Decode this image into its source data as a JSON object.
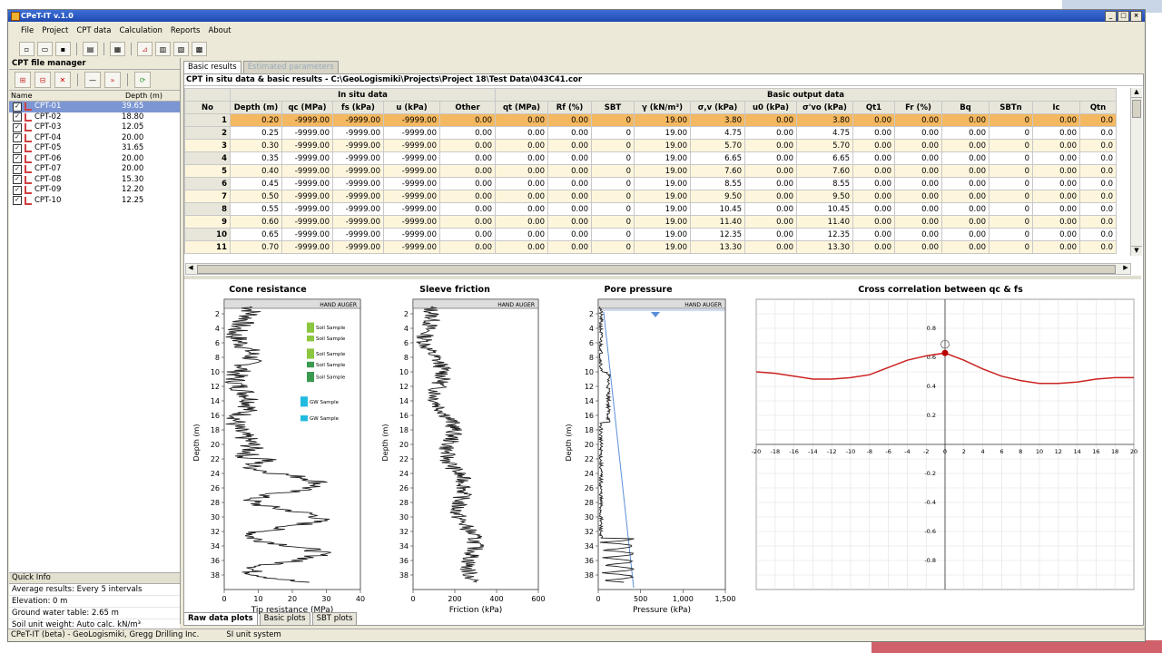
{
  "window": {
    "title": "CPeT-IT v.1.0"
  },
  "menu": [
    "File",
    "Project",
    "CPT data",
    "Calculation",
    "Reports",
    "About"
  ],
  "file_manager": {
    "title": "CPT file manager",
    "col_name": "Name",
    "col_depth": "Depth (m)",
    "files": [
      {
        "name": "CPT-01",
        "depth": "39.65"
      },
      {
        "name": "CPT-02",
        "depth": "18.80"
      },
      {
        "name": "CPT-03",
        "depth": "12.05"
      },
      {
        "name": "CPT-04",
        "depth": "20.00"
      },
      {
        "name": "CPT-05",
        "depth": "31.65"
      },
      {
        "name": "CPT-06",
        "depth": "20.00"
      },
      {
        "name": "CPT-07",
        "depth": "20.00"
      },
      {
        "name": "CPT-08",
        "depth": "15.30"
      },
      {
        "name": "CPT-09",
        "depth": "12.20"
      },
      {
        "name": "CPT-10",
        "depth": "12.25"
      }
    ]
  },
  "quick_info": {
    "title": "Quick Info",
    "lines": [
      "Average results: Every 5 intervals",
      "Elevation: 0 m",
      "Ground water table: 2.65 m",
      "Soil unit weight: Auto calc. kN/m³"
    ]
  },
  "tabs": {
    "basic": "Basic results",
    "estimated": "Estimated parameters"
  },
  "path": "CPT in situ data & basic results - C:\\GeoLogismiki\\Projects\\Project 18\\Test Data\\043C41.cor",
  "table": {
    "group_insitu": "In situ data",
    "group_output": "Basic output data",
    "columns": [
      "No",
      "Depth (m)",
      "qc (MPa)",
      "fs (kPa)",
      "u (kPa)",
      "Other",
      "qt (MPa)",
      "Rf (%)",
      "SBT",
      "γ (kN/m³)",
      "σ,v (kPa)",
      "u0 (kPa)",
      "σ'vo (kPa)",
      "Qt1",
      "Fr (%)",
      "Bq",
      "SBTn",
      "Ic",
      "Qtn"
    ],
    "rows": [
      [
        "1",
        "0.20",
        "-9999.00",
        "-9999.00",
        "-9999.00",
        "0.00",
        "0.00",
        "0.00",
        "0",
        "19.00",
        "3.80",
        "0.00",
        "3.80",
        "0.00",
        "0.00",
        "0.00",
        "0",
        "0.00",
        "0.0"
      ],
      [
        "2",
        "0.25",
        "-9999.00",
        "-9999.00",
        "-9999.00",
        "0.00",
        "0.00",
        "0.00",
        "0",
        "19.00",
        "4.75",
        "0.00",
        "4.75",
        "0.00",
        "0.00",
        "0.00",
        "0",
        "0.00",
        "0.0"
      ],
      [
        "3",
        "0.30",
        "-9999.00",
        "-9999.00",
        "-9999.00",
        "0.00",
        "0.00",
        "0.00",
        "0",
        "19.00",
        "5.70",
        "0.00",
        "5.70",
        "0.00",
        "0.00",
        "0.00",
        "0",
        "0.00",
        "0.0"
      ],
      [
        "4",
        "0.35",
        "-9999.00",
        "-9999.00",
        "-9999.00",
        "0.00",
        "0.00",
        "0.00",
        "0",
        "19.00",
        "6.65",
        "0.00",
        "6.65",
        "0.00",
        "0.00",
        "0.00",
        "0",
        "0.00",
        "0.0"
      ],
      [
        "5",
        "0.40",
        "-9999.00",
        "-9999.00",
        "-9999.00",
        "0.00",
        "0.00",
        "0.00",
        "0",
        "19.00",
        "7.60",
        "0.00",
        "7.60",
        "0.00",
        "0.00",
        "0.00",
        "0",
        "0.00",
        "0.0"
      ],
      [
        "6",
        "0.45",
        "-9999.00",
        "-9999.00",
        "-9999.00",
        "0.00",
        "0.00",
        "0.00",
        "0",
        "19.00",
        "8.55",
        "0.00",
        "8.55",
        "0.00",
        "0.00",
        "0.00",
        "0",
        "0.00",
        "0.0"
      ],
      [
        "7",
        "0.50",
        "-9999.00",
        "-9999.00",
        "-9999.00",
        "0.00",
        "0.00",
        "0.00",
        "0",
        "19.00",
        "9.50",
        "0.00",
        "9.50",
        "0.00",
        "0.00",
        "0.00",
        "0",
        "0.00",
        "0.0"
      ],
      [
        "8",
        "0.55",
        "-9999.00",
        "-9999.00",
        "-9999.00",
        "0.00",
        "0.00",
        "0.00",
        "0",
        "19.00",
        "10.45",
        "0.00",
        "10.45",
        "0.00",
        "0.00",
        "0.00",
        "0",
        "0.00",
        "0.0"
      ],
      [
        "9",
        "0.60",
        "-9999.00",
        "-9999.00",
        "-9999.00",
        "0.00",
        "0.00",
        "0.00",
        "0",
        "19.00",
        "11.40",
        "0.00",
        "11.40",
        "0.00",
        "0.00",
        "0.00",
        "0",
        "0.00",
        "0.0"
      ],
      [
        "10",
        "0.65",
        "-9999.00",
        "-9999.00",
        "-9999.00",
        "0.00",
        "0.00",
        "0.00",
        "0",
        "19.00",
        "12.35",
        "0.00",
        "12.35",
        "0.00",
        "0.00",
        "0.00",
        "0",
        "0.00",
        "0.0"
      ],
      [
        "11",
        "0.70",
        "-9999.00",
        "-9999.00",
        "-9999.00",
        "0.00",
        "0.00",
        "0.00",
        "0",
        "19.00",
        "13.30",
        "0.00",
        "13.30",
        "0.00",
        "0.00",
        "0.00",
        "0",
        "0.00",
        "0.0"
      ]
    ]
  },
  "plots": {
    "cone": {
      "title": "Cone resistance",
      "xlabel": "Tip resistance (MPa)",
      "ylabel": "Depth (m)",
      "band": "HAND AUGER",
      "xticks": [
        "0",
        "10",
        "20",
        "30",
        "40"
      ],
      "samples": [
        "Soil Sample",
        "Soil Sample",
        "Soil Sample",
        "Soil Sample",
        "Soil Sample",
        "GW Sample",
        "GW Sample"
      ]
    },
    "sleeve": {
      "title": "Sleeve friction",
      "xlabel": "Friction (kPa)",
      "ylabel": "Depth (m)",
      "band": "HAND AUGER",
      "xticks": [
        "0",
        "200",
        "400",
        "600"
      ]
    },
    "pore": {
      "title": "Pore pressure",
      "xlabel": "Pressure (kPa)",
      "ylabel": "Depth (m)",
      "band": "HAND AUGER",
      "xticks": [
        "0",
        "500",
        "1,000",
        "1,500"
      ]
    },
    "depth_ticks": [
      "2",
      "4",
      "6",
      "8",
      "10",
      "12",
      "14",
      "16",
      "18",
      "20",
      "22",
      "24",
      "26",
      "28",
      "30",
      "32",
      "34",
      "36",
      "38"
    ],
    "cross": {
      "title": "Cross correlation between qc & fs",
      "xticks": [
        "-20",
        "-18",
        "-16",
        "-14",
        "-12",
        "-10",
        "-8",
        "-6",
        "-4",
        "-2",
        "0",
        "2",
        "4",
        "6",
        "8",
        "10",
        "12",
        "14",
        "16",
        "18",
        "20"
      ],
      "yticks": [
        "0.8",
        "0.6",
        "0.4",
        "0.2",
        "-0.2",
        "-0.4",
        "-0.6",
        "-0.8"
      ],
      "line_color": "#cc2222"
    }
  },
  "chart_data": {
    "type": "line",
    "title": "Cross correlation between qc & fs",
    "x": [
      -20,
      -18,
      -16,
      -14,
      -12,
      -10,
      -8,
      -6,
      -4,
      -2,
      0,
      2,
      4,
      6,
      8,
      10,
      12,
      14,
      16,
      18,
      20
    ],
    "y": [
      0.5,
      0.49,
      0.47,
      0.45,
      0.45,
      0.46,
      0.48,
      0.53,
      0.58,
      0.61,
      0.63,
      0.58,
      0.52,
      0.47,
      0.44,
      0.42,
      0.42,
      0.43,
      0.45,
      0.46,
      0.46
    ],
    "xlim": [
      -20,
      20
    ],
    "ylim": [
      -1,
      1
    ]
  },
  "bottom_tabs": [
    "Raw data plots",
    "Basic plots",
    "SBT plots"
  ],
  "status": [
    "CPeT-IT (beta) - GeoLogismiki, Gregg Drilling Inc.",
    "SI unit system"
  ]
}
